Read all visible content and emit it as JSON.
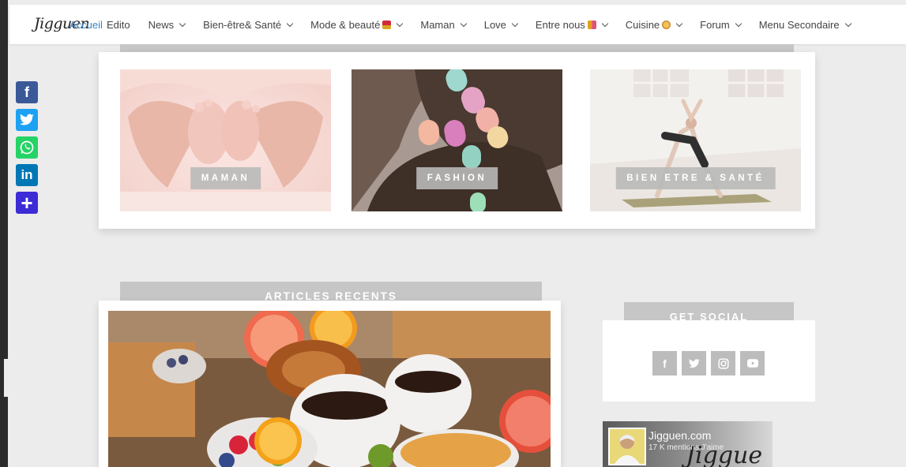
{
  "brand": {
    "logo_text": "Jigguen",
    "home_link": "Accueil"
  },
  "nav": {
    "items": [
      {
        "label": "Edito",
        "has_dropdown": false
      },
      {
        "label": "News",
        "has_dropdown": true
      },
      {
        "label": "Bien-être& Santé",
        "has_dropdown": true
      },
      {
        "label": "Mode & beauté",
        "has_dropdown": true,
        "emoji": "lipstick-icon"
      },
      {
        "label": "Maman",
        "has_dropdown": true
      },
      {
        "label": "Love",
        "has_dropdown": true
      },
      {
        "label": "Entre nous",
        "has_dropdown": true,
        "emoji": "women-icon"
      },
      {
        "label": "Cuisine",
        "has_dropdown": true,
        "emoji": "food-icon"
      },
      {
        "label": "Forum",
        "has_dropdown": true
      },
      {
        "label": "Menu Secondaire",
        "has_dropdown": true
      }
    ]
  },
  "share_bar": [
    {
      "name": "facebook-share-icon",
      "glyph": "f",
      "color": "#3b5998"
    },
    {
      "name": "twitter-share-icon",
      "glyph": "t",
      "color": "#1da1f2"
    },
    {
      "name": "whatsapp-share-icon",
      "glyph": "w",
      "color": "#25d366"
    },
    {
      "name": "linkedin-share-icon",
      "glyph": "in",
      "color": "#0077b5"
    },
    {
      "name": "more-share-icon",
      "glyph": "+",
      "color": "#3d2bd6"
    }
  ],
  "categories": [
    {
      "label": "MAMAN"
    },
    {
      "label": "FASHION"
    },
    {
      "label": "BIEN ETRE & SANTÉ"
    }
  ],
  "articles": {
    "header": "ARTICLES RECENTS"
  },
  "social": {
    "header": "GET SOCIAL",
    "icons": [
      "facebook-icon",
      "twitter-icon",
      "instagram-icon",
      "youtube-icon"
    ]
  },
  "fb_widget": {
    "page_name": "Jigguen.com",
    "likes": "17 K mentions J'aime",
    "watermark": "Jiggue"
  },
  "colors": {
    "accent_link": "#3b82c4",
    "header_gray": "#c6c6c6",
    "page_bg": "#ececec"
  }
}
